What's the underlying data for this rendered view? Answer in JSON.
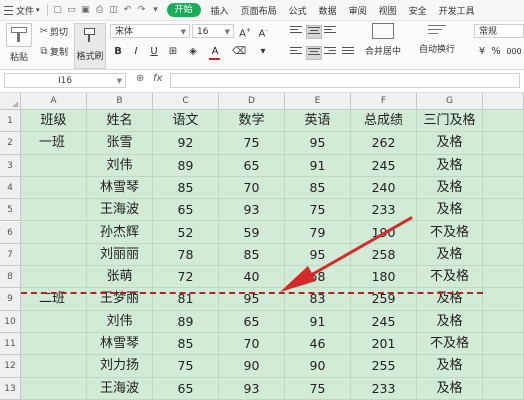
{
  "menu": {
    "file_label": "文件",
    "tabs": [
      "开始",
      "插入",
      "页面布局",
      "公式",
      "数据",
      "审阅",
      "视图",
      "安全",
      "开发工具"
    ],
    "active_tab": "开始"
  },
  "ribbon": {
    "paste_label": "粘贴",
    "cut_label": "剪切",
    "copy_label": "复制",
    "format_painter_label": "格式刷",
    "font_name": "宋体",
    "font_size": "16",
    "bold": "B",
    "italic": "I",
    "underline": "U",
    "font_color_glyph": "A",
    "merge_label": "合并居中",
    "wrap_label": "自动换行",
    "number_format": "常规",
    "percent": "%",
    "thousands": "000"
  },
  "formula_bar": {
    "cell_ref": "I16",
    "fx": "fx",
    "value": ""
  },
  "sheet": {
    "columns": [
      "A",
      "B",
      "C",
      "D",
      "E",
      "F",
      "G"
    ],
    "row_numbers": [
      "1",
      "2",
      "3",
      "4",
      "5",
      "6",
      "7",
      "8",
      "9",
      "10",
      "11",
      "12",
      "13"
    ],
    "rows": [
      [
        "班级",
        "姓名",
        "语文",
        "数学",
        "英语",
        "总成绩",
        "三门及格"
      ],
      [
        "一班",
        "张雪",
        "92",
        "75",
        "95",
        "262",
        "及格"
      ],
      [
        "",
        "刘伟",
        "89",
        "65",
        "91",
        "245",
        "及格"
      ],
      [
        "",
        "林雪琴",
        "85",
        "70",
        "85",
        "240",
        "及格"
      ],
      [
        "",
        "王海波",
        "65",
        "93",
        "75",
        "233",
        "及格"
      ],
      [
        "",
        "孙杰辉",
        "52",
        "59",
        "79",
        "190",
        "不及格"
      ],
      [
        "",
        "刘丽丽",
        "78",
        "85",
        "95",
        "258",
        "及格"
      ],
      [
        "",
        "张萌",
        "72",
        "40",
        "68",
        "180",
        "不及格"
      ],
      [
        "二班",
        "王梦丽",
        "81",
        "95",
        "83",
        "259",
        "及格"
      ],
      [
        "",
        "刘伟",
        "89",
        "65",
        "91",
        "245",
        "及格"
      ],
      [
        "",
        "林雪琴",
        "85",
        "70",
        "46",
        "201",
        "不及格"
      ],
      [
        "",
        "刘力扬",
        "75",
        "90",
        "90",
        "255",
        "及格"
      ],
      [
        "",
        "王海波",
        "65",
        "93",
        "75",
        "233",
        "及格"
      ]
    ]
  },
  "colors": {
    "active_tab": "#1aad59",
    "cell_fill": "#d1ebd6",
    "page_break_line": "#b52020",
    "arrow": "#d42a2a"
  }
}
